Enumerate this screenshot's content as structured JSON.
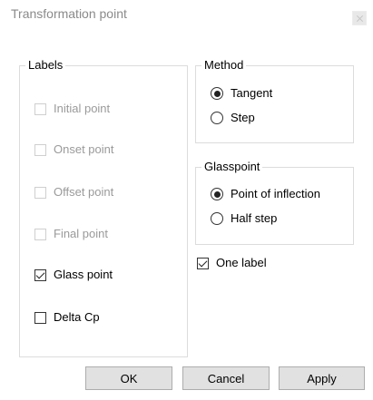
{
  "window": {
    "title": "Transformation point",
    "close_icon": "close-icon"
  },
  "labels_group": {
    "legend": "Labels",
    "items": [
      {
        "label": "Initial point",
        "checked": false,
        "enabled": false
      },
      {
        "label": "Onset point",
        "checked": false,
        "enabled": false
      },
      {
        "label": "Offset point",
        "checked": false,
        "enabled": false
      },
      {
        "label": "Final point",
        "checked": false,
        "enabled": false
      },
      {
        "label": "Glass point",
        "checked": true,
        "enabled": true
      },
      {
        "label": "Delta Cp",
        "checked": false,
        "enabled": true
      }
    ]
  },
  "method_group": {
    "legend": "Method",
    "options": [
      {
        "label": "Tangent",
        "selected": true
      },
      {
        "label": "Step",
        "selected": false
      }
    ]
  },
  "glasspoint_group": {
    "legend": "Glasspoint",
    "options": [
      {
        "label": "Point of inflection",
        "selected": true
      },
      {
        "label": "Half step",
        "selected": false
      }
    ]
  },
  "one_label": {
    "label": "One label",
    "checked": true
  },
  "buttons": {
    "ok": "OK",
    "cancel": "Cancel",
    "apply": "Apply"
  }
}
